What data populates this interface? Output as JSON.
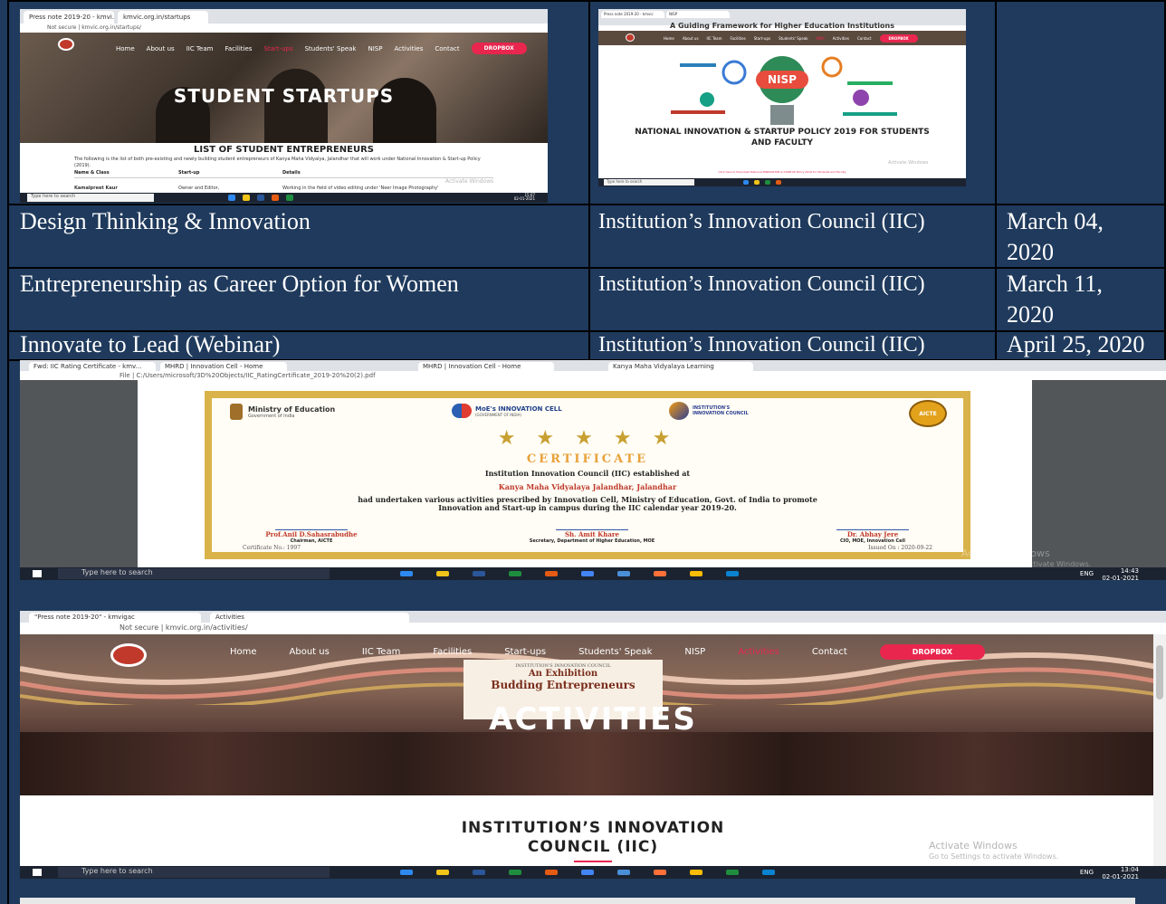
{
  "rows": [
    {
      "event": "Design Thinking & Innovation",
      "organizer": "Institution’s Innovation Council (IIC)",
      "date": "March 04, 2020"
    },
    {
      "event": "Entrepreneurship as Career Option for Women",
      "organizer": "Institution’s Innovation Council (IIC)",
      "date": "March 11, 2020"
    },
    {
      "event": "Innovate to Lead (Webinar)",
      "organizer": "Institution’s Innovation Council (IIC)",
      "date": "April 25, 2020"
    }
  ],
  "startups_shot": {
    "tab1": "Press note 2019-20 - kmvi...",
    "tab2": "kmvic.org.in/startups",
    "address": "Not secure | kmvic.org.in/startups/",
    "nav": [
      "Home",
      "About us",
      "IIC Team",
      "Facilities",
      "Start-ups",
      "Students' Speak",
      "NISP",
      "Activities",
      "Contact"
    ],
    "dropbox": "DROPBOX",
    "hero_title": "STUDENT STARTUPS",
    "heading": "LIST OF STUDENT ENTREPRENEURS",
    "intro": "The following is the list of both pre-existing and newly building student entrepreneurs of Kanya Maha Vidyalya, Jalandhar that will work under National Innovation & Start-up Policy (2019).",
    "columns": [
      "Name & Class",
      "Start-up",
      "Details"
    ],
    "row": [
      "Kamalpreet Kaur",
      "Owner and Editor,",
      "Working in the field of video editing under 'Neer Image Photography'"
    ],
    "watermark": "Activate Windows",
    "taskbar_search": "Type here to search",
    "clock_time": "15:07",
    "clock_date": "02-01-2021"
  },
  "nisp_shot": {
    "tab1": "Press note 2019-20 - kmvic",
    "tab2": "NISP",
    "banner_title": "A Guiding Framework for Higher Education Institutions",
    "nav": [
      "Home",
      "About us",
      "IIC Team",
      "Facilities",
      "Start-ups",
      "Students' Speak",
      "NISP",
      "Activities",
      "Contact"
    ],
    "dropbox": "DROPBOX",
    "logo": "NISP",
    "title_line1": "NATIONAL INNOVATION & STARTUP POLICY 2019 FOR STUDENTS",
    "title_line2": "AND FACULTY",
    "link": "Click here to Download National INNOVATION & STARTUP Policy 2019 for Students and Faculty",
    "watermark": "Activate Windows",
    "taskbar_search": "Type here to search"
  },
  "certificate_shot": {
    "tabs": [
      "Fwd: IIC Rating Certificate - kmv...",
      "MHRD | Innovation Cell - Home",
      "MHRD | Innovation Cell - Home",
      "Kanya Maha Vidyalaya Learning"
    ],
    "address": "File  |  C:/Users/microsoft/3D%20Objects/IIC_RatingCertificate_2019-20%20(2).pdf",
    "logo_moe": "Ministry of Education",
    "logo_moe_sub": "Government of India",
    "logo_mic": "MoE's INNOVATION CELL",
    "logo_mic_sub": "(GOVERNMENT OF INDIA)",
    "logo_iic": "INSTITUTION'S INNOVATION COUNCIL",
    "logo_aicte": "AICTE",
    "stars": "★ ★ ★ ★ ★",
    "title": "CERTIFICATE",
    "line1": "Institution Innovation Council (IIC) established at",
    "institute": "Kanya Maha Vidyalaya Jalandhar, Jalandhar",
    "body": "had undertaken various activities prescribed by Innovation Cell, Ministry of Education, Govt. of India to promote Innovation and Start-up in campus during the IIC calendar year 2019-20.",
    "signatories": [
      {
        "name": "Prof.Anil D.Sahasrabudhe",
        "role": "Chairman, AICTE"
      },
      {
        "name": "Sh. Amit Khare",
        "role": "Secretary, Department of Higher Education, MOE"
      },
      {
        "name": "Dr. Abhay Jere",
        "role": "CIO, MOE, Innovation Cell"
      }
    ],
    "cert_no": "Certificate No.: 1997",
    "issued_on": "Issued On : 2020-09-22",
    "watermark1": "Activate Windows",
    "watermark2": "Go to Settings to activate Windows.",
    "taskbar_search": "Type here to search",
    "lang": "ENG",
    "clock_time": "14:43",
    "clock_date": "02-01-2021"
  },
  "activities_shot": {
    "tabs": [
      "\"Press note 2019-20\" - kmvigac",
      "Activities"
    ],
    "address": "Not secure  |  kmvic.org.in/activities/",
    "nav": [
      "Home",
      "About us",
      "IIC Team",
      "Facilities",
      "Start-ups",
      "Students' Speak",
      "NISP",
      "Activities",
      "Contact"
    ],
    "dropbox": "DROPBOX",
    "banner_small": "INSTITUTION'S INNOVATION COUNCIL",
    "banner_line1": "An Exhibition",
    "banner_line2": "Budding Entrepreneurs",
    "hero_title": "ACTIVITIES",
    "heading_line1": "INSTITUTION’S INNOVATION",
    "heading_line2": "COUNCIL (IIC)",
    "watermark1": "Activate Windows",
    "watermark2": "Go to Settings to activate Windows.",
    "taskbar_search": "Type here to search",
    "lang": "ENG",
    "clock_time": "13:04",
    "clock_date": "02-01-2021"
  },
  "colors": {
    "background": "#1f3a5c",
    "dropbox": "#e8264e",
    "certificate_gold": "#d9b34a",
    "certificate_red": "#c0392b"
  }
}
